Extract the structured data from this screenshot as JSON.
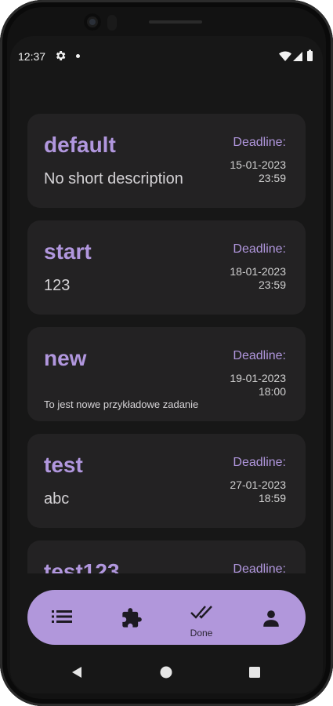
{
  "status": {
    "time": "12:37"
  },
  "tasks": [
    {
      "title": "default",
      "description": "No short description",
      "desc_small": false,
      "deadline_label": "Deadline:",
      "date": "15-01-2023",
      "time": "23:59"
    },
    {
      "title": "start",
      "description": "123",
      "desc_small": false,
      "deadline_label": "Deadline:",
      "date": "18-01-2023",
      "time": "23:59"
    },
    {
      "title": "new",
      "description": "To jest nowe przykładowe zadanie",
      "desc_small": true,
      "deadline_label": "Deadline:",
      "date": "19-01-2023",
      "time": "18:00"
    },
    {
      "title": "test",
      "description": "abc",
      "desc_small": false,
      "deadline_label": "Deadline:",
      "date": "27-01-2023",
      "time": "18:59"
    },
    {
      "title": "test123",
      "description": "",
      "desc_small": false,
      "deadline_label": "Deadline:",
      "date": "",
      "time": ""
    }
  ],
  "bottom_nav": {
    "items": [
      {
        "icon": "list-icon",
        "label": ""
      },
      {
        "icon": "puzzle-icon",
        "label": ""
      },
      {
        "icon": "done-all-icon",
        "label": "Done"
      },
      {
        "icon": "person-icon",
        "label": ""
      }
    ]
  },
  "colors": {
    "accent": "#b197de",
    "card": "#232223",
    "background": "#171717",
    "nav": "#b197db"
  }
}
